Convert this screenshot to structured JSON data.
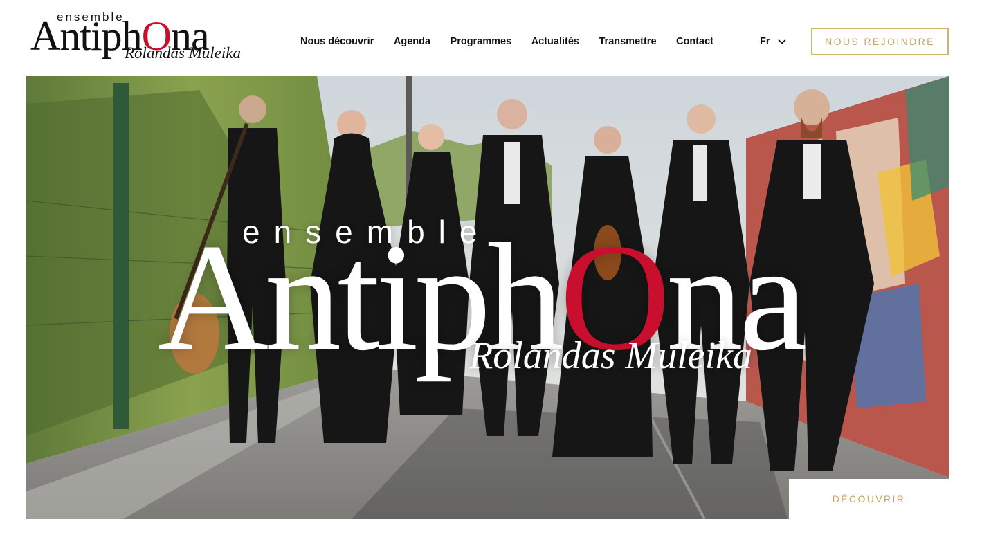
{
  "logo": {
    "ensemble": "ensemble",
    "main_a": "Antiph",
    "main_o": "O",
    "main_b": "na",
    "sub": "Rolandas Muleika"
  },
  "nav": {
    "items": [
      {
        "label": "Nous découvrir"
      },
      {
        "label": "Agenda"
      },
      {
        "label": "Programmes"
      },
      {
        "label": "Actualités"
      },
      {
        "label": "Transmettre"
      },
      {
        "label": "Contact"
      }
    ]
  },
  "language": {
    "selected": "Fr",
    "icon": "chevron-down-icon"
  },
  "join_button": {
    "label": "NOUS REJOINDRE"
  },
  "hero": {
    "ensemble": "ensemble",
    "main_a": "Antiph",
    "main_o": "O",
    "main_b": "na",
    "sub": "Rolandas Muleika",
    "discover_label": "DÉCOUVRIR"
  },
  "colors": {
    "accent_gold": "#c9a55a",
    "brand_red": "#c8102e",
    "text": "#111111"
  }
}
